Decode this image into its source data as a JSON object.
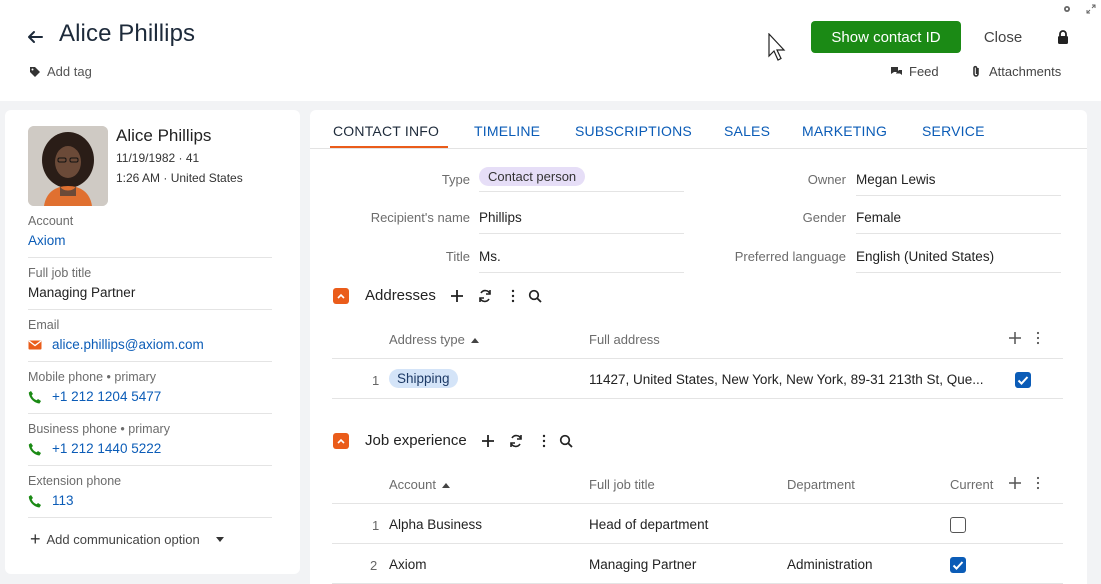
{
  "header": {
    "title": "Alice Phillips",
    "add_tag": "Add tag",
    "show_contact_id": "Show contact ID",
    "close": "Close",
    "feed": "Feed",
    "attachments": "Attachments"
  },
  "profile": {
    "name": "Alice Phillips",
    "dob_age": "11/19/1982 · 41",
    "time_location": "1:26 AM · United States",
    "fields": [
      {
        "label": "Account",
        "value": "Axiom"
      },
      {
        "label": "Full job title",
        "value": "Managing Partner"
      },
      {
        "label": "Email",
        "value": "alice.phillips@axiom.com"
      },
      {
        "label": "Mobile phone • primary",
        "value": "+1 212 1204 5477"
      },
      {
        "label": "Business phone • primary",
        "value": "+1 212 1440 5222"
      },
      {
        "label": "Extension phone",
        "value": "113"
      }
    ],
    "add_communication": "Add communication option"
  },
  "tabs": [
    "CONTACT INFO",
    "TIMELINE",
    "SUBSCRIPTIONS",
    "SALES",
    "MARKETING",
    "SERVICE"
  ],
  "contact_info": {
    "left": [
      {
        "label": "Type",
        "value": "Contact person"
      },
      {
        "label": "Recipient's name",
        "value": "Phillips"
      },
      {
        "label": "Title",
        "value": "Ms."
      }
    ],
    "right": [
      {
        "label": "Owner",
        "value": "Megan Lewis"
      },
      {
        "label": "Gender",
        "value": "Female"
      },
      {
        "label": "Preferred language",
        "value": "English (United States)"
      }
    ]
  },
  "addresses": {
    "title": "Addresses",
    "columns": [
      "Address type",
      "Full address"
    ],
    "rows": [
      {
        "num": "1",
        "type": "Shipping",
        "address": "11427, United States, New York, New York, 89-31 213th St, Que...",
        "checked": true
      }
    ]
  },
  "job_experience": {
    "title": "Job experience",
    "columns": [
      "Account",
      "Full job title",
      "Department",
      "Current"
    ],
    "rows": [
      {
        "num": "1",
        "account": "Alpha Business",
        "job_title": "Head of department",
        "department": "",
        "current": false
      },
      {
        "num": "2",
        "account": "Axiom",
        "job_title": "Managing Partner",
        "department": "Administration",
        "current": true
      }
    ]
  },
  "colors": {
    "accent_orange": "#ea5c1a",
    "primary_green": "#1b8a15",
    "link_blue": "#0b5cb7"
  }
}
